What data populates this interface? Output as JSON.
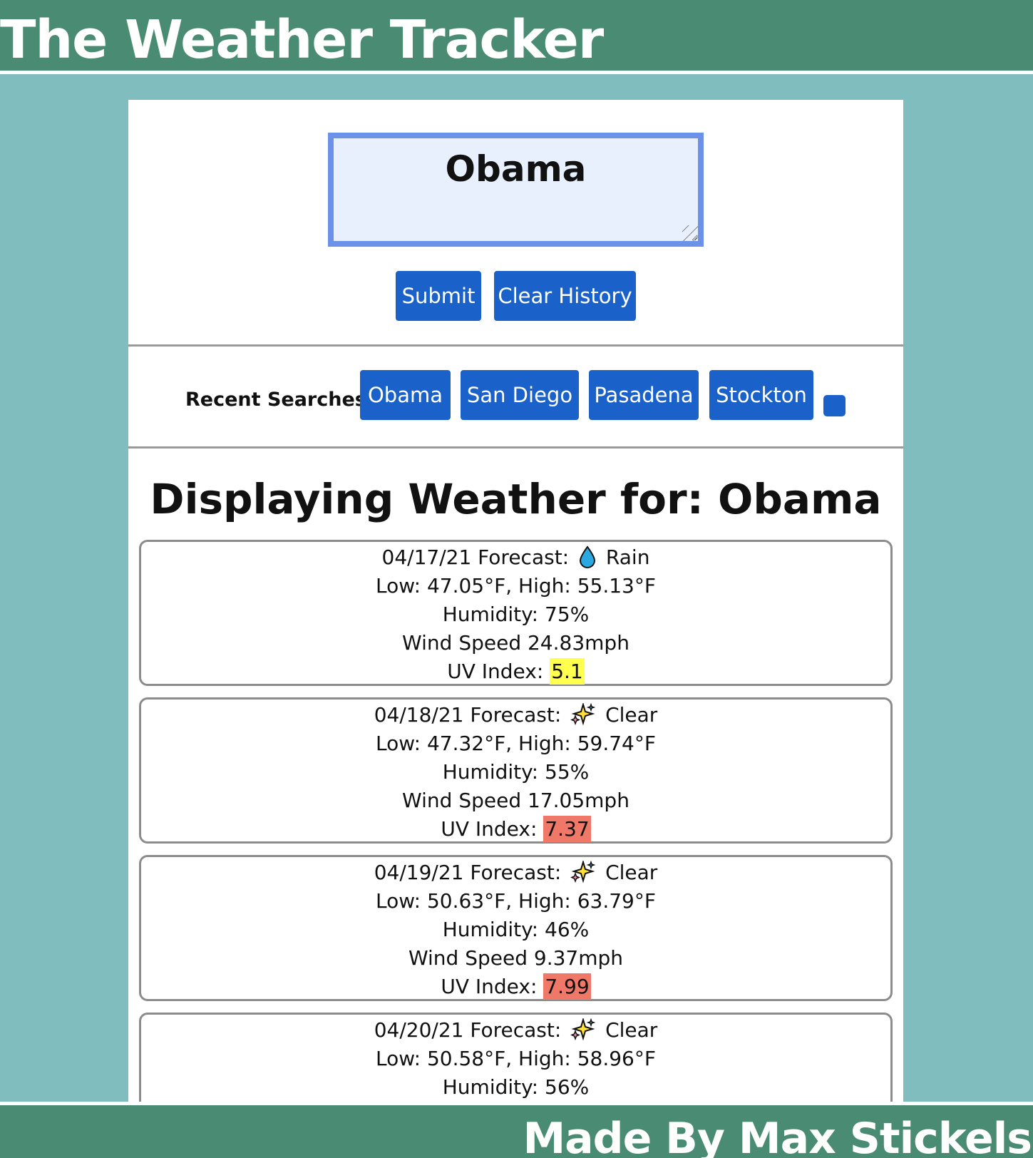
{
  "header": {
    "title": "The Weather Tracker"
  },
  "search": {
    "value": "Obama",
    "submit_label": "Submit",
    "clear_label": "Clear History"
  },
  "recent": {
    "label": "Recent Searches:",
    "items": [
      "Obama",
      "San Diego",
      "Pasadena",
      "Stockton"
    ]
  },
  "display": {
    "title": "Displaying Weather for: Obama"
  },
  "forecasts": [
    {
      "date_line": "04/17/21 Forecast:",
      "icon": "droplet-icon",
      "condition": "Rain",
      "temps": "Low: 47.05°F, High: 55.13°F",
      "humidity": "Humidity: 75%",
      "wind": "Wind Speed 24.83mph",
      "uv_label": "UV Index:",
      "uv_value": "5.1",
      "uv_color": "#ffff4d"
    },
    {
      "date_line": "04/18/21 Forecast:",
      "icon": "sparkles-icon",
      "condition": "Clear",
      "temps": "Low: 47.32°F, High: 59.74°F",
      "humidity": "Humidity: 55%",
      "wind": "Wind Speed 17.05mph",
      "uv_label": "UV Index:",
      "uv_value": "7.37",
      "uv_color": "#f07868"
    },
    {
      "date_line": "04/19/21 Forecast:",
      "icon": "sparkles-icon",
      "condition": "Clear",
      "temps": "Low: 50.63°F, High: 63.79°F",
      "humidity": "Humidity: 46%",
      "wind": "Wind Speed 9.37mph",
      "uv_label": "UV Index:",
      "uv_value": "7.99",
      "uv_color": "#f07868"
    },
    {
      "date_line": "04/20/21 Forecast:",
      "icon": "sparkles-icon",
      "condition": "Clear",
      "temps": "Low: 50.58°F, High: 58.96°F",
      "humidity": "Humidity: 56%"
    }
  ],
  "footer": {
    "credit": "Made By Max Stickels"
  }
}
